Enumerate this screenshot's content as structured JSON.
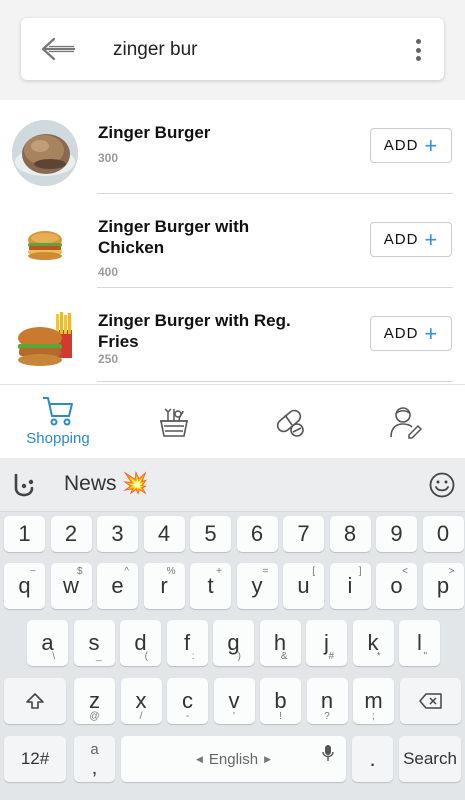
{
  "search": {
    "query": "zinger bur"
  },
  "results": [
    {
      "name": "Zinger Burger",
      "price": "300",
      "add_label": "ADD"
    },
    {
      "name": "Zinger Burger with Chicken",
      "price": "400",
      "add_label": "ADD"
    },
    {
      "name": "Zinger Burger with Reg. Fries",
      "price": "250",
      "add_label": "ADD"
    }
  ],
  "bottom_nav": {
    "items": [
      {
        "label": "Shopping",
        "icon": "cart-icon",
        "active": true
      },
      {
        "label": "",
        "icon": "grocery-basket-icon"
      },
      {
        "label": "",
        "icon": "pills-icon"
      },
      {
        "label": "",
        "icon": "doctor-icon"
      }
    ],
    "active_color": "#2b8cc4"
  },
  "keyboard": {
    "suggestion": "News",
    "suggestion_emoji": "💥",
    "numbers": [
      "1",
      "2",
      "3",
      "4",
      "5",
      "6",
      "7",
      "8",
      "9",
      "0"
    ],
    "row1": [
      {
        "k": "q",
        "h": "~"
      },
      {
        "k": "w",
        "h": "$"
      },
      {
        "k": "e",
        "h": "^"
      },
      {
        "k": "r",
        "h": "%"
      },
      {
        "k": "t",
        "h": "+"
      },
      {
        "k": "y",
        "h": "="
      },
      {
        "k": "u",
        "h": "["
      },
      {
        "k": "i",
        "h": "]"
      },
      {
        "k": "o",
        "h": "<"
      },
      {
        "k": "p",
        "h": ">"
      }
    ],
    "row2": [
      {
        "k": "a",
        "h": "\\"
      },
      {
        "k": "s",
        "h": "_"
      },
      {
        "k": "d",
        "h": "("
      },
      {
        "k": "f",
        "h": ":"
      },
      {
        "k": "g",
        "h": ")"
      },
      {
        "k": "h",
        "h": "&"
      },
      {
        "k": "j",
        "h": "#"
      },
      {
        "k": "k",
        "h": "*"
      },
      {
        "k": "l",
        "h": "\""
      }
    ],
    "row3": [
      {
        "k": "z",
        "h": "@"
      },
      {
        "k": "x",
        "h": "/"
      },
      {
        "k": "c",
        "h": "-"
      },
      {
        "k": "v",
        "h": "'"
      },
      {
        "k": "b",
        "h": "!"
      },
      {
        "k": "n",
        "h": "?"
      },
      {
        "k": "m",
        "h": ";"
      }
    ],
    "symbols_label": "12#",
    "comma_top": "a",
    "comma_bottom": ",",
    "space_label": "English",
    "period_label": ".",
    "action_label": "Search"
  }
}
